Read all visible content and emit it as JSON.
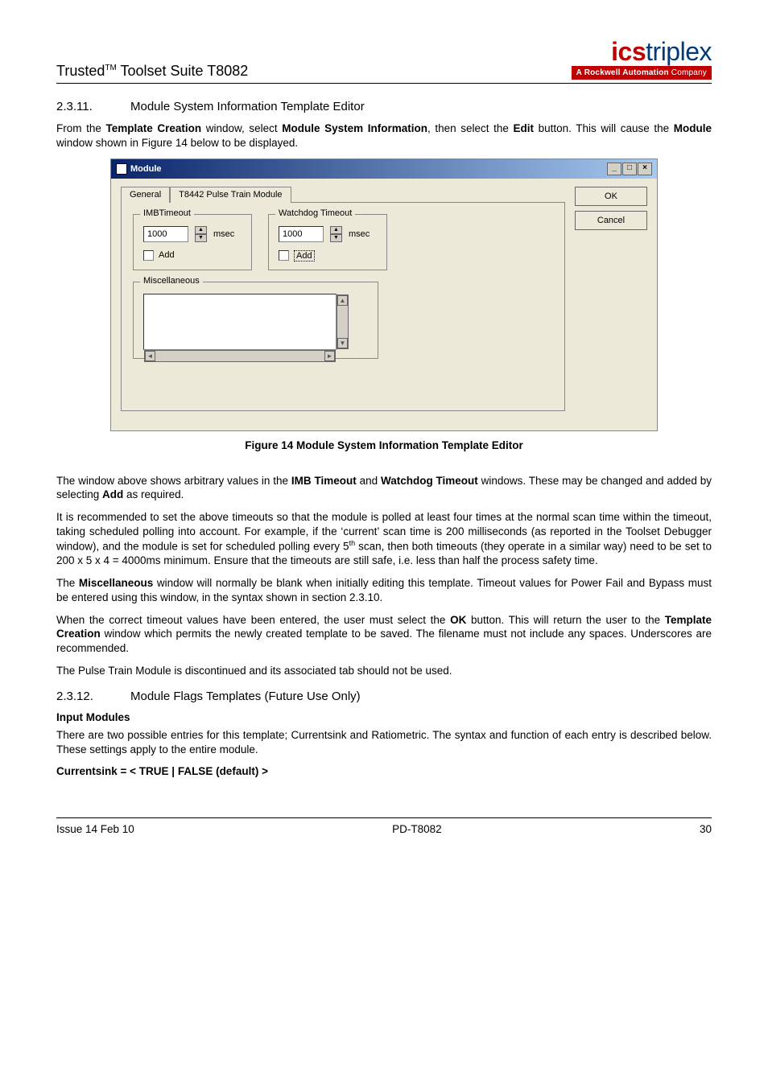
{
  "header": {
    "left_html_pre": "Trusted",
    "left_tm": "TM",
    "left_html_post": " Toolset Suite T8082",
    "logo_ics": "ics",
    "logo_triplex": "triplex",
    "logo_sub_bold": "A Rockwell Automation",
    "logo_sub_rest": " Company"
  },
  "section_2311": {
    "num": "2.3.11.",
    "title": "Module System Information Template Editor",
    "para1_pre": "From the ",
    "para1_b1": "Template Creation",
    "para1_mid": " window, select ",
    "para1_b2": "Module System Information",
    "para1_mid2": ", then select the ",
    "para1_b3": "Edit",
    "para1_post": " button.  This will cause the ",
    "para1_b4": "Module",
    "para1_end": " window shown in Figure 14 below to be displayed."
  },
  "dialog": {
    "title": "Module",
    "tab_general": "General",
    "tab_t8442": "T8442 Pulse Train Module",
    "imb_title": "IMBTimeout",
    "watchdog_title": "Watchdog Timeout",
    "imb_value": "1000",
    "watchdog_value": "1000",
    "unit": "msec",
    "add_lbl": "Add",
    "add_lbl2": "Add",
    "misc_title": "Miscellaneous",
    "ok": "OK",
    "cancel": "Cancel"
  },
  "figure_caption": "Figure 14 Module System Information Template Editor",
  "paras": {
    "p2_pre": "The window above shows arbitrary values in the ",
    "p2_b1": "IMB Timeout",
    "p2_mid": " and ",
    "p2_b2": "Watchdog Timeout",
    "p2_mid2": " windows.  These may be changed and added by selecting ",
    "p2_b3": "Add",
    "p2_end": " as required.",
    "p3_pre": "It is recommended to set the above timeouts so that the module is polled at least four times at the normal scan time within the timeout, taking scheduled polling into account. For example, if the ‘current’ scan time is 200 milliseconds (as reported in the Toolset Debugger window), and the module is set for scheduled polling every 5",
    "p3_th": "th",
    "p3_post": " scan, then both timeouts (they operate in a similar way) need to be set to 200 x 5 x 4 = 4000ms minimum. Ensure that the timeouts are still safe, i.e. less than half the process safety time.",
    "p4_pre": "The ",
    "p4_b1": "Miscellaneous",
    "p4_end": " window will normally be blank when initially editing this template.  Timeout values for Power Fail and Bypass must be entered using this window, in the syntax shown in section 2.3.10.",
    "p5_pre": "When the correct timeout values have been entered, the user must select the ",
    "p5_b1": "OK",
    "p5_mid": " button.  This will return the user to the ",
    "p5_b2": "Template Creation",
    "p5_end": " window which permits the newly created template to be saved. The filename must not include any spaces. Underscores are recommended.",
    "p6": "The Pulse Train Module is discontinued and its associated tab should not be used."
  },
  "section_2312": {
    "num": "2.3.12.",
    "title": "Module Flags Templates (Future Use Only)",
    "subhead": "Input Modules",
    "para": "There are two possible entries for this template; Currentsink and Ratiometric. The syntax and function of each entry is described below. These settings apply to the entire module.",
    "code": "Currentsink = < TRUE | FALSE (default) >"
  },
  "footer": {
    "left": "Issue 14 Feb 10",
    "center": "PD-T8082",
    "right": "30"
  }
}
